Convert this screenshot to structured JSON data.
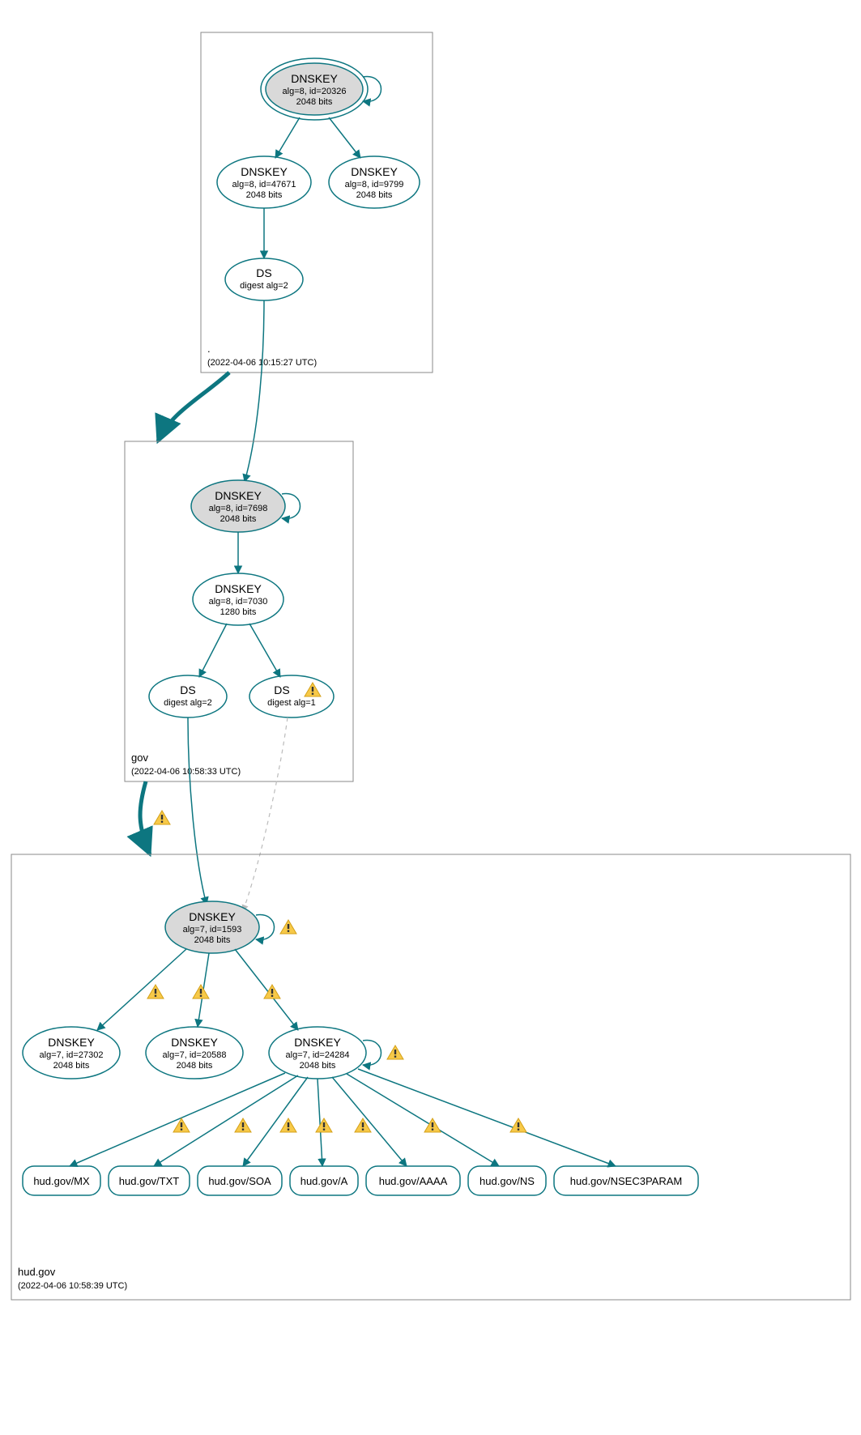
{
  "colors": {
    "stroke": "#0d7680",
    "ksk_fill": "#d9d9d9"
  },
  "zones": {
    "root": {
      "name": ".",
      "timestamp": "(2022-04-06 10:15:27 UTC)"
    },
    "gov": {
      "name": "gov",
      "timestamp": "(2022-04-06 10:58:33 UTC)"
    },
    "hudgov": {
      "name": "hud.gov",
      "timestamp": "(2022-04-06 10:58:39 UTC)"
    }
  },
  "nodes": {
    "root_ksk": {
      "title": "DNSKEY",
      "line2": "alg=8, id=20326",
      "line3": "2048 bits"
    },
    "root_zsk1": {
      "title": "DNSKEY",
      "line2": "alg=8, id=47671",
      "line3": "2048 bits"
    },
    "root_zsk2": {
      "title": "DNSKEY",
      "line2": "alg=8, id=9799",
      "line3": "2048 bits"
    },
    "root_ds": {
      "title": "DS",
      "line2": "digest alg=2"
    },
    "gov_ksk": {
      "title": "DNSKEY",
      "line2": "alg=8, id=7698",
      "line3": "2048 bits"
    },
    "gov_zsk": {
      "title": "DNSKEY",
      "line2": "alg=8, id=7030",
      "line3": "1280 bits"
    },
    "gov_ds1": {
      "title": "DS",
      "line2": "digest alg=2"
    },
    "gov_ds2": {
      "title": "DS",
      "line2": "digest alg=1"
    },
    "hud_ksk": {
      "title": "DNSKEY",
      "line2": "alg=7, id=1593",
      "line3": "2048 bits"
    },
    "hud_zsk1": {
      "title": "DNSKEY",
      "line2": "alg=7, id=27302",
      "line3": "2048 bits"
    },
    "hud_zsk2": {
      "title": "DNSKEY",
      "line2": "alg=7, id=20588",
      "line3": "2048 bits"
    },
    "hud_zsk3": {
      "title": "DNSKEY",
      "line2": "alg=7, id=24284",
      "line3": "2048 bits"
    },
    "rr_mx": {
      "label": "hud.gov/MX"
    },
    "rr_txt": {
      "label": "hud.gov/TXT"
    },
    "rr_soa": {
      "label": "hud.gov/SOA"
    },
    "rr_a": {
      "label": "hud.gov/A"
    },
    "rr_aaaa": {
      "label": "hud.gov/AAAA"
    },
    "rr_ns": {
      "label": "hud.gov/NS"
    },
    "rr_nsec3": {
      "label": "hud.gov/NSEC3PARAM"
    }
  }
}
